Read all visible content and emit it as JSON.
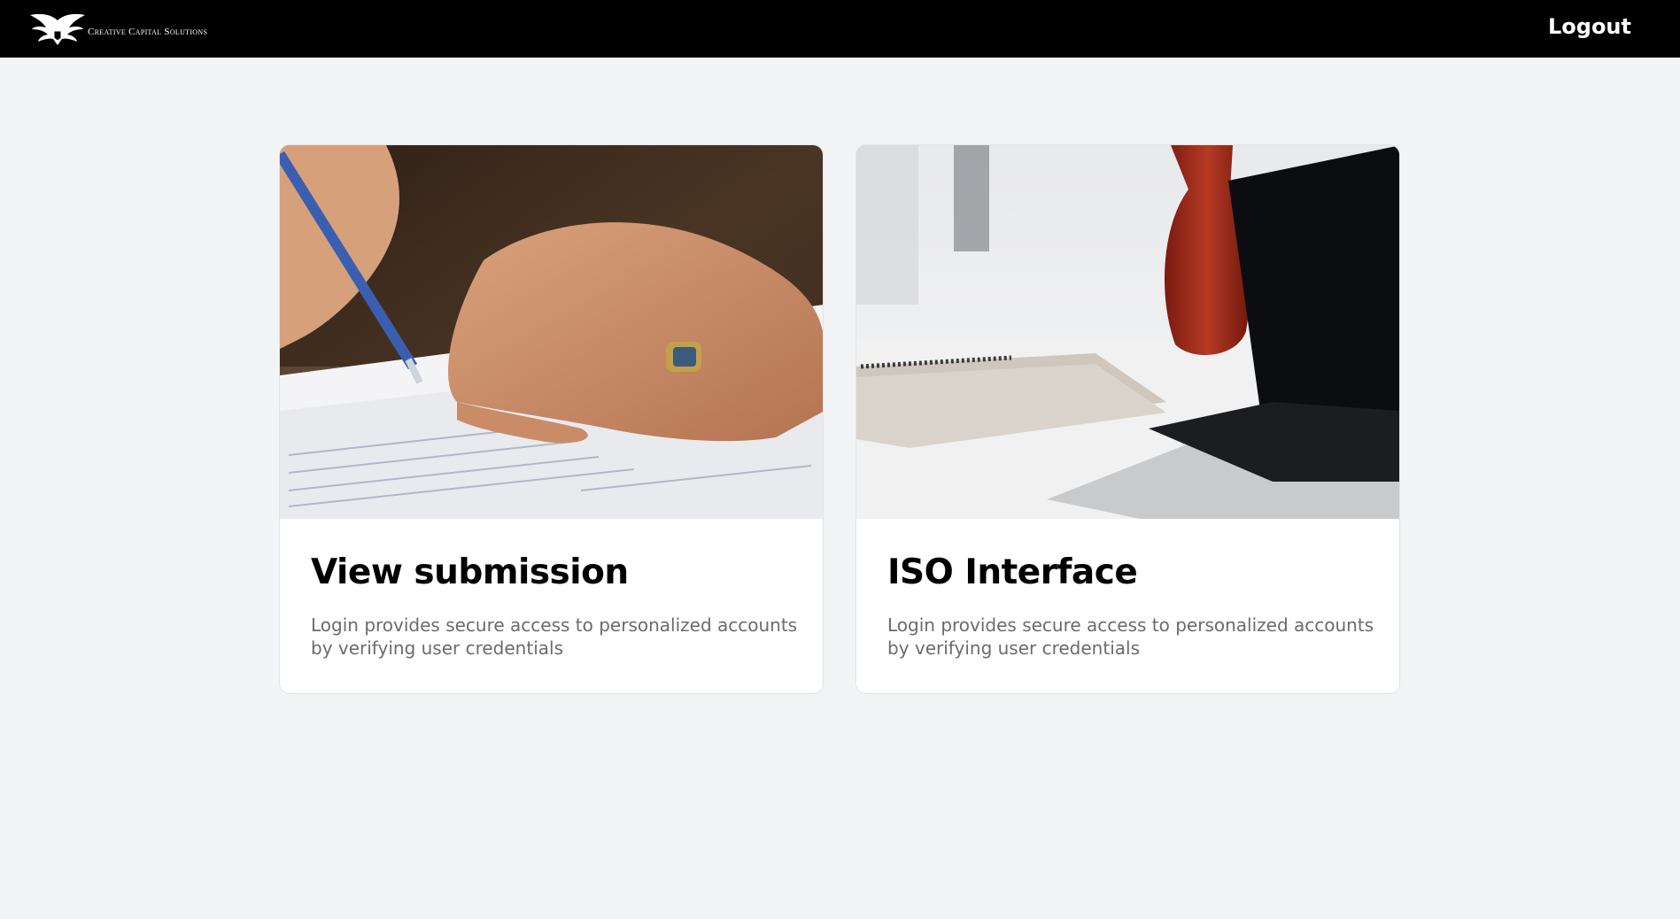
{
  "header": {
    "logo_text": "Creative Capital Solutions",
    "logout_label": "Logout",
    "background": "#000000"
  },
  "cards": [
    {
      "title": "View submission",
      "description": "Login provides secure access to personalized accounts by verifying user credentials",
      "image_icon": "hand-signing-document-image"
    },
    {
      "title": "ISO Interface",
      "description": "Login provides secure access to personalized accounts by verifying user credentials",
      "image_icon": "laptop-notebook-desk-image"
    }
  ]
}
